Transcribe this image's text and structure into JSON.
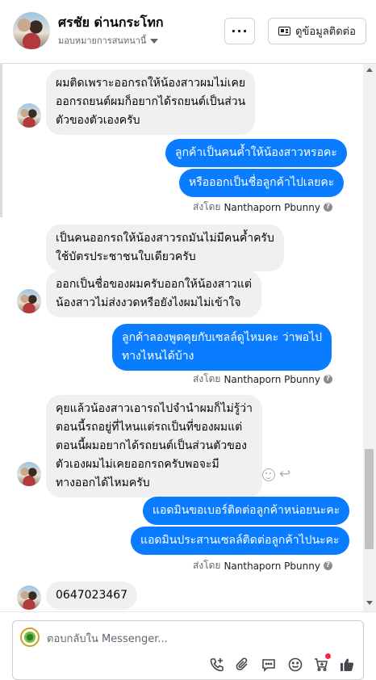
{
  "header": {
    "contact_name": "ศรชัย ด่านกระโทก",
    "assign_label": "มอบหมายการสนทนานี้",
    "more_label": "···",
    "contact_info_label": "ดูข้อมูลติดต่อ"
  },
  "messages": [
    {
      "side": "in",
      "lines": [
        "ผมติดเพราะออกรถให้น้องสาวผมไม่เคย",
        "ออกรถยนต์ผมก็อยากได้รถยนต์เป็นส่วน",
        "ตัวของตัวเองครับ"
      ]
    },
    {
      "side": "out",
      "lines": [
        "ลูกค้าเป็นคนค้ำให้น้องสาวหรอคะ"
      ]
    },
    {
      "side": "out",
      "lines": [
        "หรือออกเป็นชื่อลูกค้าไปเลยคะ"
      ]
    },
    {
      "side": "in",
      "lines": [
        "เป็นคนออกรถให้น้องสาวรถมันไม่มีคนค้ำครับ",
        "ใช้บัตรประชาชนใบเดียวครับ"
      ]
    },
    {
      "side": "in",
      "lines": [
        "ออกเป็นชื่อของผมครับออกให้น้องสาวแต่",
        "น้องสาวไม่ส่งงวดหรือยังไงผมไม่เข้าใจ"
      ]
    },
    {
      "side": "out",
      "lines": [
        "ลูกค้าลองพูดคุยกับเซลล์ดูไหมคะ ว่าพอไป",
        "ทางไหนได้บ้าง"
      ]
    },
    {
      "side": "in",
      "lines": [
        "คุยแล้วน้องสาวเอารถไปจำนำผมก็ไม่รู้ว่า",
        "ตอนนี้รถอยู่ที่ไหนแต่รถเป็นที่ของผมแต่",
        "ตอนนี้ผมอยากได้รถยนต์เป็นส่วนตัวของ",
        "ตัวเองผมไม่เคยออกรถครับพอจะมี",
        "ทางออกได้ไหมครับ"
      ]
    },
    {
      "side": "out",
      "lines": [
        "แอดมินขอเบอร์ติดต่อลูกค้าหน่อยนะคะ"
      ]
    },
    {
      "side": "out",
      "lines": [
        "แอดมินประสานเซลล์ติดต่อลูกค้าไปนะคะ"
      ]
    },
    {
      "side": "in",
      "lines": [
        "0647023467"
      ]
    }
  ],
  "sent_by": {
    "prefix": "ส่งโดย",
    "name": "Nanthaporn Pbunny",
    "info_icon": "?"
  },
  "composer": {
    "placeholder": "ตอบกลับใน Messenger..."
  },
  "toolbar_icons": [
    "call-add-icon",
    "attachment-icon",
    "saved-reply-icon",
    "emoji-icon",
    "cart-icon",
    "like-icon"
  ]
}
